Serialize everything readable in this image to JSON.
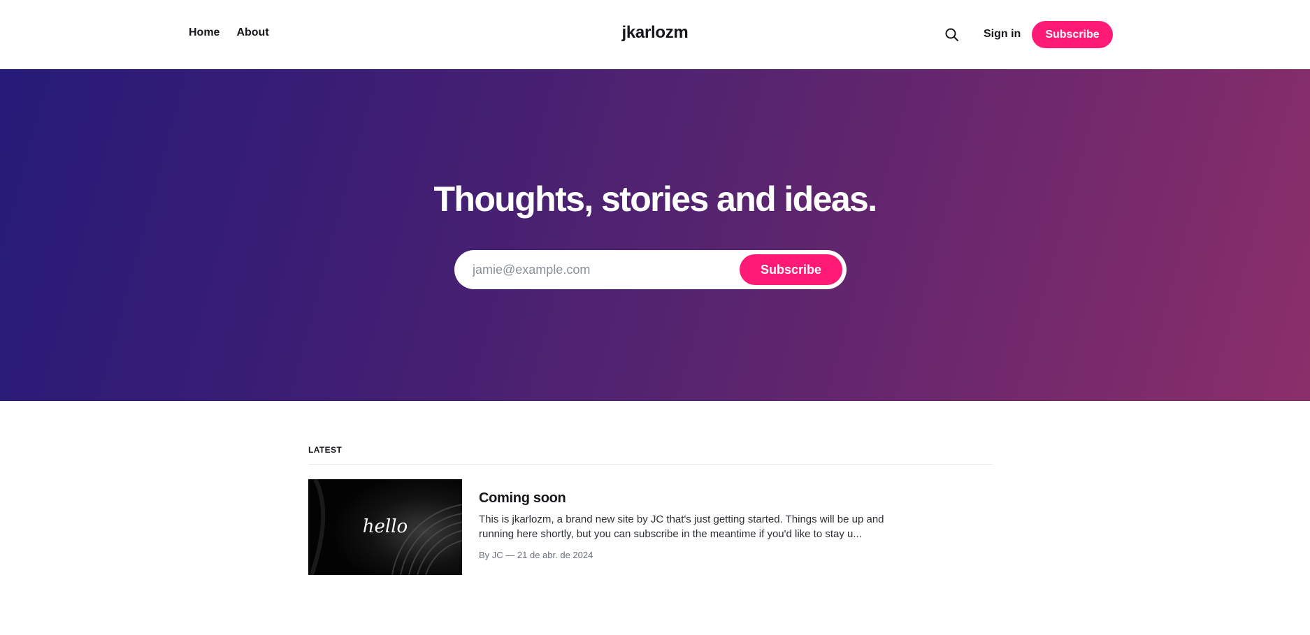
{
  "header": {
    "nav": [
      "Home",
      "About"
    ],
    "site_title": "jkarlozm",
    "signin_label": "Sign in",
    "subscribe_label": "Subscribe",
    "search_icon": "search-icon"
  },
  "hero": {
    "title": "Thoughts, stories and ideas.",
    "email_placeholder": "jamie@example.com",
    "subscribe_label": "Subscribe"
  },
  "latest": {
    "label": "LATEST",
    "posts": [
      {
        "title": "Coming soon",
        "excerpt": "This is jkarlozm, a brand new site by JC that's just getting started. Things will be up and running here shortly, but you can subscribe in the meantime if you'd like to stay u...",
        "meta": "By JC — 21 de abr. de 2024",
        "image_text": "hello"
      }
    ]
  },
  "colors": {
    "accent": "#ff1a75",
    "hero_gradient_start": "#261b79",
    "hero_gradient_end": "#8b2f6a"
  }
}
